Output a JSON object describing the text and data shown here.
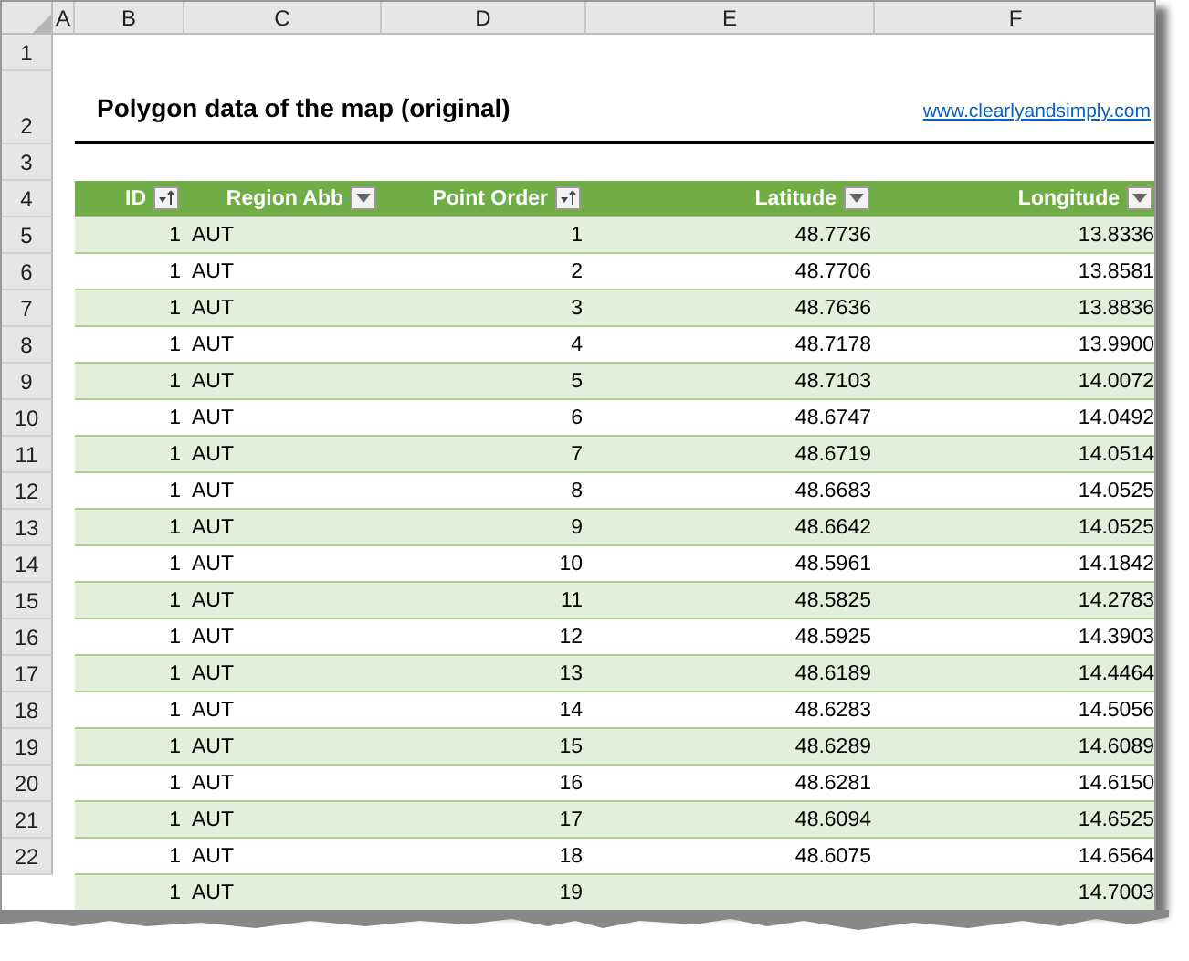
{
  "column_headers": [
    "A",
    "B",
    "C",
    "D",
    "E",
    "F"
  ],
  "row_numbers": [
    "1",
    "2",
    "3",
    "4",
    "5",
    "6",
    "7",
    "8",
    "9",
    "10",
    "11",
    "12",
    "13",
    "14",
    "15",
    "16",
    "17",
    "18",
    "19",
    "20",
    "21",
    "22"
  ],
  "title": "Polygon data of the map (original)",
  "link": "www.clearlyandsimply.com",
  "table": {
    "columns": [
      {
        "label": "ID",
        "sorted": true
      },
      {
        "label": "Region Abb",
        "sorted": false
      },
      {
        "label": "Point Order",
        "sorted": true
      },
      {
        "label": "Latitude",
        "sorted": false
      },
      {
        "label": "Longitude",
        "sorted": false
      }
    ],
    "rows": [
      [
        "1",
        "AUT",
        "1",
        "48.7736",
        "13.8336"
      ],
      [
        "1",
        "AUT",
        "2",
        "48.7706",
        "13.8581"
      ],
      [
        "1",
        "AUT",
        "3",
        "48.7636",
        "13.8836"
      ],
      [
        "1",
        "AUT",
        "4",
        "48.7178",
        "13.9900"
      ],
      [
        "1",
        "AUT",
        "5",
        "48.7103",
        "14.0072"
      ],
      [
        "1",
        "AUT",
        "6",
        "48.6747",
        "14.0492"
      ],
      [
        "1",
        "AUT",
        "7",
        "48.6719",
        "14.0514"
      ],
      [
        "1",
        "AUT",
        "8",
        "48.6683",
        "14.0525"
      ],
      [
        "1",
        "AUT",
        "9",
        "48.6642",
        "14.0525"
      ],
      [
        "1",
        "AUT",
        "10",
        "48.5961",
        "14.1842"
      ],
      [
        "1",
        "AUT",
        "11",
        "48.5825",
        "14.2783"
      ],
      [
        "1",
        "AUT",
        "12",
        "48.5925",
        "14.3903"
      ],
      [
        "1",
        "AUT",
        "13",
        "48.6189",
        "14.4464"
      ],
      [
        "1",
        "AUT",
        "14",
        "48.6283",
        "14.5056"
      ],
      [
        "1",
        "AUT",
        "15",
        "48.6289",
        "14.6089"
      ],
      [
        "1",
        "AUT",
        "16",
        "48.6281",
        "14.6150"
      ],
      [
        "1",
        "AUT",
        "17",
        "48.6094",
        "14.6525"
      ],
      [
        "1",
        "AUT",
        "18",
        "48.6075",
        "14.6564"
      ],
      [
        "1",
        "AUT",
        "19",
        "",
        "14.7003"
      ]
    ]
  }
}
